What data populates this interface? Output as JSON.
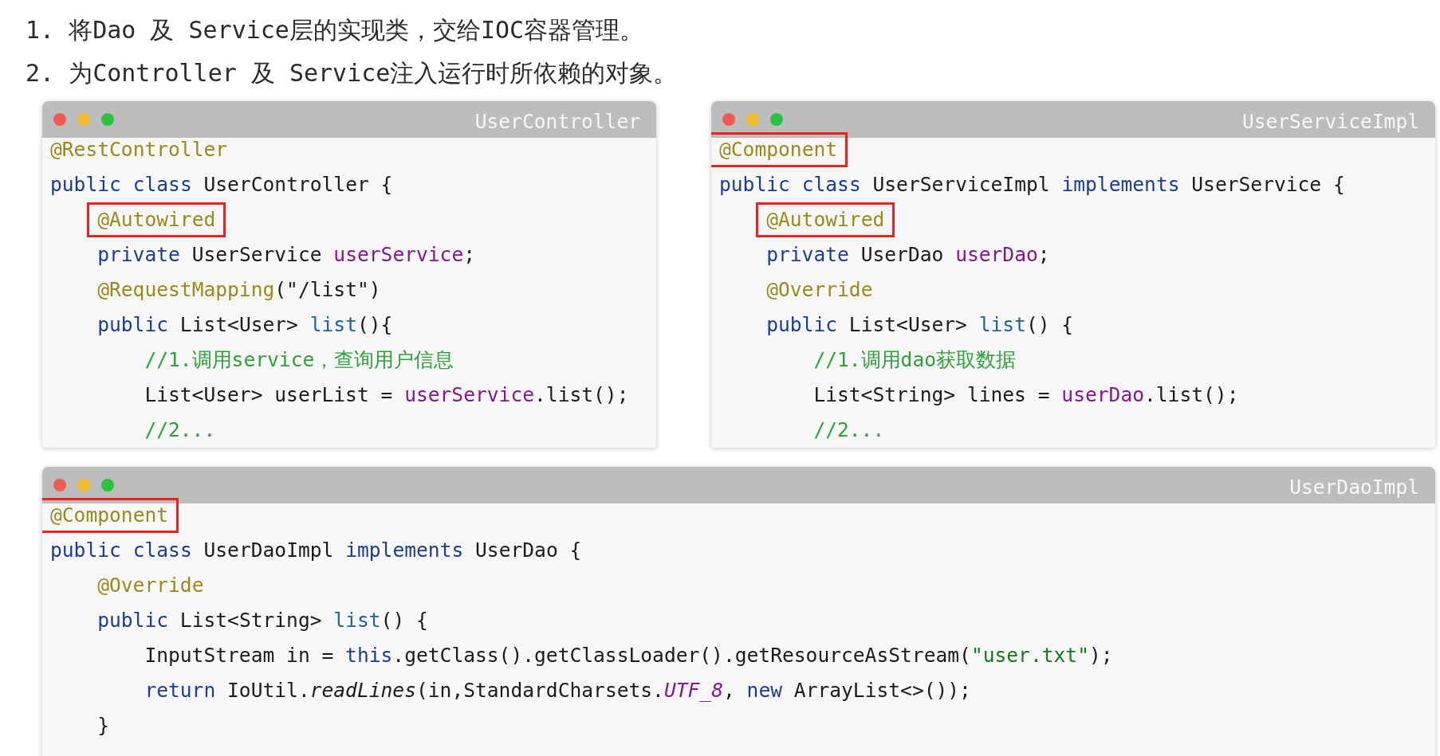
{
  "instructions": [
    "1. 将Dao 及 Service层的实现类，交给IOC容器管理。",
    "2. 为Controller 及 Service注入运行时所依赖的对象。"
  ],
  "windows": [
    {
      "title": "UserController",
      "lines": [
        {
          "boxed": false,
          "tokens": [
            {
              "text": "@RestController",
              "kind": "annotation"
            }
          ]
        },
        {
          "boxed": false,
          "tokens": [
            {
              "text": "public ",
              "kind": "keyword"
            },
            {
              "text": "class ",
              "kind": "keyword"
            },
            {
              "text": "UserController {",
              "kind": "plain"
            }
          ],
          "children": [
            {
              "boxed": true,
              "tokens": [
                {
                  "text": "@Autowired",
                  "kind": "annotation"
                }
              ]
            },
            {
              "boxed": false,
              "tokens": [
                {
                  "text": "private ",
                  "kind": "keyword"
                },
                {
                  "text": "UserService ",
                  "kind": "plain"
                },
                {
                  "text": "userService",
                  "kind": "field"
                },
                {
                  "text": ";",
                  "kind": "plain"
                }
              ]
            },
            {
              "boxed": false,
              "tokens": [
                {
                  "text": "@RequestMapping",
                  "kind": "annotation"
                },
                {
                  "text": "(\"/list\")",
                  "kind": "plain"
                }
              ]
            },
            {
              "boxed": false,
              "tokens": [
                {
                  "text": "public ",
                  "kind": "keyword"
                },
                {
                  "text": "List<User> ",
                  "kind": "plain"
                },
                {
                  "text": "list",
                  "kind": "method"
                },
                {
                  "text": "(){",
                  "kind": "plain"
                }
              ],
              "children": [
                {
                  "boxed": false,
                  "tokens": [
                    {
                      "text": "//1.调用service，查询用户信息",
                      "kind": "comment"
                    }
                  ]
                },
                {
                  "boxed": false,
                  "tokens": [
                    {
                      "text": "List<User> userList = ",
                      "kind": "plain"
                    },
                    {
                      "text": "userService",
                      "kind": "field"
                    },
                    {
                      "text": ".list();",
                      "kind": "plain"
                    }
                  ]
                },
                {
                  "boxed": false,
                  "tokens": [
                    {
                      "text": "//2...",
                      "kind": "comment"
                    }
                  ]
                }
              ]
            }
          ]
        }
      ]
    },
    {
      "title": "UserServiceImpl",
      "lines": [
        {
          "boxed": true,
          "tokens": [
            {
              "text": "@Component",
              "kind": "annotation"
            }
          ]
        },
        {
          "boxed": false,
          "tokens": [
            {
              "text": "public ",
              "kind": "keyword"
            },
            {
              "text": "class ",
              "kind": "keyword"
            },
            {
              "text": "UserServiceImpl ",
              "kind": "plain"
            },
            {
              "text": "implements ",
              "kind": "keyword"
            },
            {
              "text": "UserService {",
              "kind": "plain"
            }
          ],
          "children": [
            {
              "boxed": true,
              "tokens": [
                {
                  "text": "@Autowired",
                  "kind": "annotation"
                }
              ]
            },
            {
              "boxed": false,
              "tokens": [
                {
                  "text": "private ",
                  "kind": "keyword"
                },
                {
                  "text": "UserDao ",
                  "kind": "plain"
                },
                {
                  "text": "userDao",
                  "kind": "field"
                },
                {
                  "text": ";",
                  "kind": "plain"
                }
              ]
            },
            {
              "boxed": false,
              "tokens": [
                {
                  "text": "@Override",
                  "kind": "annotation"
                }
              ]
            },
            {
              "boxed": false,
              "tokens": [
                {
                  "text": "public ",
                  "kind": "keyword"
                },
                {
                  "text": "List<User> ",
                  "kind": "plain"
                },
                {
                  "text": "list",
                  "kind": "method"
                },
                {
                  "text": "() {",
                  "kind": "plain"
                }
              ],
              "children": [
                {
                  "boxed": false,
                  "tokens": [
                    {
                      "text": "//1.调用dao获取数据",
                      "kind": "comment"
                    }
                  ]
                },
                {
                  "boxed": false,
                  "tokens": [
                    {
                      "text": "List<String> lines = ",
                      "kind": "plain"
                    },
                    {
                      "text": "userDao",
                      "kind": "field"
                    },
                    {
                      "text": ".list();",
                      "kind": "plain"
                    }
                  ]
                },
                {
                  "boxed": false,
                  "tokens": [
                    {
                      "text": "//2...",
                      "kind": "comment"
                    }
                  ]
                }
              ]
            }
          ]
        }
      ]
    },
    {
      "title": "UserDaoImpl",
      "lines": [
        {
          "boxed": true,
          "tokens": [
            {
              "text": "@Component",
              "kind": "annotation"
            }
          ]
        },
        {
          "boxed": false,
          "tokens": [
            {
              "text": "public ",
              "kind": "keyword"
            },
            {
              "text": "class ",
              "kind": "keyword"
            },
            {
              "text": "UserDaoImpl ",
              "kind": "plain"
            },
            {
              "text": "implements ",
              "kind": "keyword"
            },
            {
              "text": "UserDao {",
              "kind": "plain"
            }
          ],
          "children": [
            {
              "boxed": false,
              "tokens": [
                {
                  "text": "@Override",
                  "kind": "annotation"
                }
              ]
            },
            {
              "boxed": false,
              "tokens": [
                {
                  "text": "public ",
                  "kind": "keyword"
                },
                {
                  "text": "List<String> ",
                  "kind": "plain"
                },
                {
                  "text": "list",
                  "kind": "method"
                },
                {
                  "text": "() {",
                  "kind": "plain"
                }
              ],
              "children": [
                {
                  "boxed": false,
                  "tokens": [
                    {
                      "text": "InputStream in = ",
                      "kind": "plain"
                    },
                    {
                      "text": "this",
                      "kind": "keyword"
                    },
                    {
                      "text": ".getClass().getClassLoader().getResourceAsStream(",
                      "kind": "plain"
                    },
                    {
                      "text": "\"user.txt\"",
                      "kind": "string"
                    },
                    {
                      "text": ");",
                      "kind": "plain"
                    }
                  ]
                },
                {
                  "boxed": false,
                  "tokens": [
                    {
                      "text": "return ",
                      "kind": "keyword"
                    },
                    {
                      "text": "IoUtil.",
                      "kind": "plain"
                    },
                    {
                      "text": "readLines",
                      "kind": "italic"
                    },
                    {
                      "text": "(in,StandardCharsets.",
                      "kind": "plain"
                    },
                    {
                      "text": "UTF_8",
                      "kind": "static"
                    },
                    {
                      "text": ", ",
                      "kind": "plain"
                    },
                    {
                      "text": "new ",
                      "kind": "keyword"
                    },
                    {
                      "text": "ArrayList<>());",
                      "kind": "plain"
                    }
                  ]
                }
              ]
            },
            {
              "boxed": false,
              "tokens": [
                {
                  "text": "}",
                  "kind": "plain"
                }
              ]
            }
          ]
        }
      ]
    }
  ]
}
